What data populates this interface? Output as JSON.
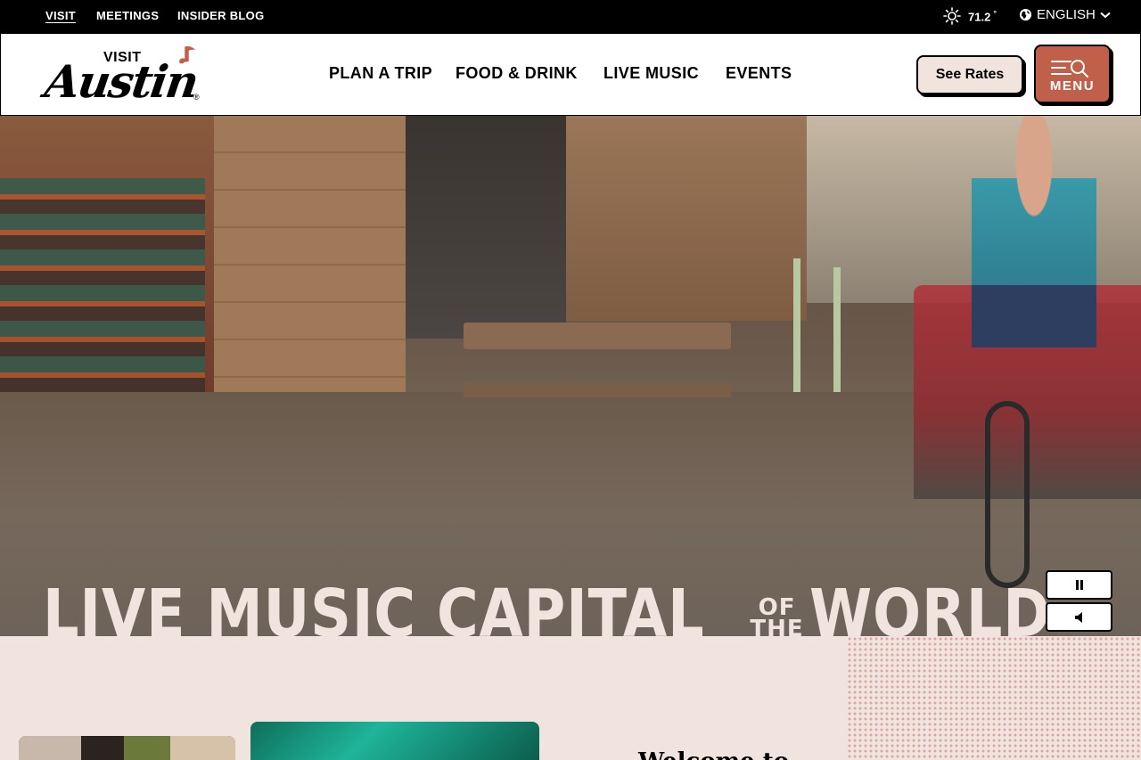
{
  "utility_nav": {
    "items": [
      {
        "label": "VISIT",
        "active": true
      },
      {
        "label": "MEETINGS",
        "active": false
      },
      {
        "label": "INSIDER BLOG",
        "active": false
      }
    ],
    "weather": {
      "temperature": "71.2",
      "unit": "°",
      "icon": "sun-icon"
    },
    "language": {
      "label": "ENGLISH",
      "icon": "globe-icon"
    }
  },
  "header": {
    "logo": {
      "visit": "VISIT",
      "name": "Austin",
      "reg": "®",
      "accent_color": "#c0604a"
    },
    "nav": [
      "PLAN A TRIP",
      "FOOD & DRINK",
      "LIVE MUSIC",
      "EVENTS"
    ],
    "see_rates_label": "See Rates",
    "menu_label": "MENU"
  },
  "hero": {
    "title_part1": "LIVE MUSIC CAPITAL",
    "title_of": "OF",
    "title_the": "THE",
    "title_part2": "WORLD",
    "title_reg": "®",
    "controls": {
      "pause_icon": "pause-icon",
      "mute_icon": "volume-icon"
    }
  },
  "intro": {
    "heading": "Welcome to"
  },
  "colors": {
    "brand_terracotta": "#c0604a",
    "cream": "#f1e4de",
    "black": "#000000"
  }
}
